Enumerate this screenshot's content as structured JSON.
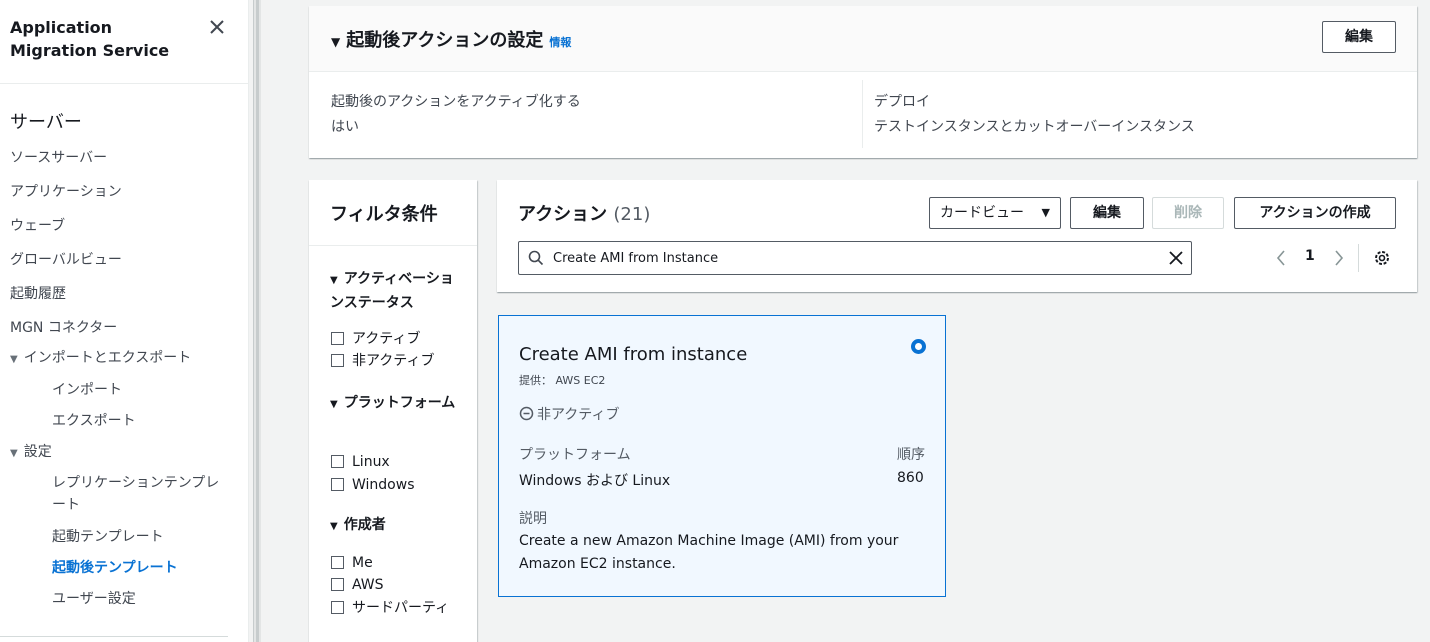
{
  "sidebar": {
    "title": "Application Migration Service",
    "section": "サーバー",
    "items": [
      {
        "label": "ソースサーバー"
      },
      {
        "label": "アプリケーション"
      },
      {
        "label": "ウェーブ"
      },
      {
        "label": "グローバルビュー"
      },
      {
        "label": "起動履歴"
      },
      {
        "label": "MGN コネクター"
      },
      {
        "label": "インポートとエクスポート"
      },
      {
        "label": "インポート"
      },
      {
        "label": "エクスポート"
      },
      {
        "label": "設定"
      },
      {
        "label": "レプリケーションテンプレート"
      },
      {
        "label": "起動テンプレート"
      },
      {
        "label": "起動後テンプレート"
      },
      {
        "label": "ユーザー設定"
      }
    ]
  },
  "settings": {
    "title": "起動後アクションの設定",
    "info": "情報",
    "edit": "編集",
    "activate_label": "起動後のアクションをアクティブ化する",
    "activate_value": "はい",
    "deploy_label": "デプロイ",
    "deploy_value": "テストインスタンスとカットオーバーインスタンス"
  },
  "filter": {
    "title": "フィルタ条件",
    "groups": [
      {
        "label": "アクティベーションステータス",
        "options": [
          "アクティブ",
          "非アクティブ"
        ]
      },
      {
        "label": "プラットフォーム",
        "options": [
          "Linux",
          "Windows"
        ]
      },
      {
        "label": "作成者",
        "options": [
          "Me",
          "AWS",
          "サードパーティ"
        ]
      }
    ]
  },
  "actions": {
    "title": "アクション",
    "count": "(21)",
    "view": "カードビュー",
    "edit": "編集",
    "delete": "削除",
    "create": "アクションの作成",
    "search_value": "Create AMI from Instance",
    "page": "1"
  },
  "card": {
    "name": "Create AMI from instance",
    "provider": "提供： AWS EC2",
    "status": "非アクティブ",
    "platform_label": "プラットフォーム",
    "platform_value": "Windows および Linux",
    "order_label": "順序",
    "order_value": "860",
    "desc_label": "説明",
    "description": "Create a new Amazon Machine Image (AMI) from your Amazon EC2 instance."
  }
}
